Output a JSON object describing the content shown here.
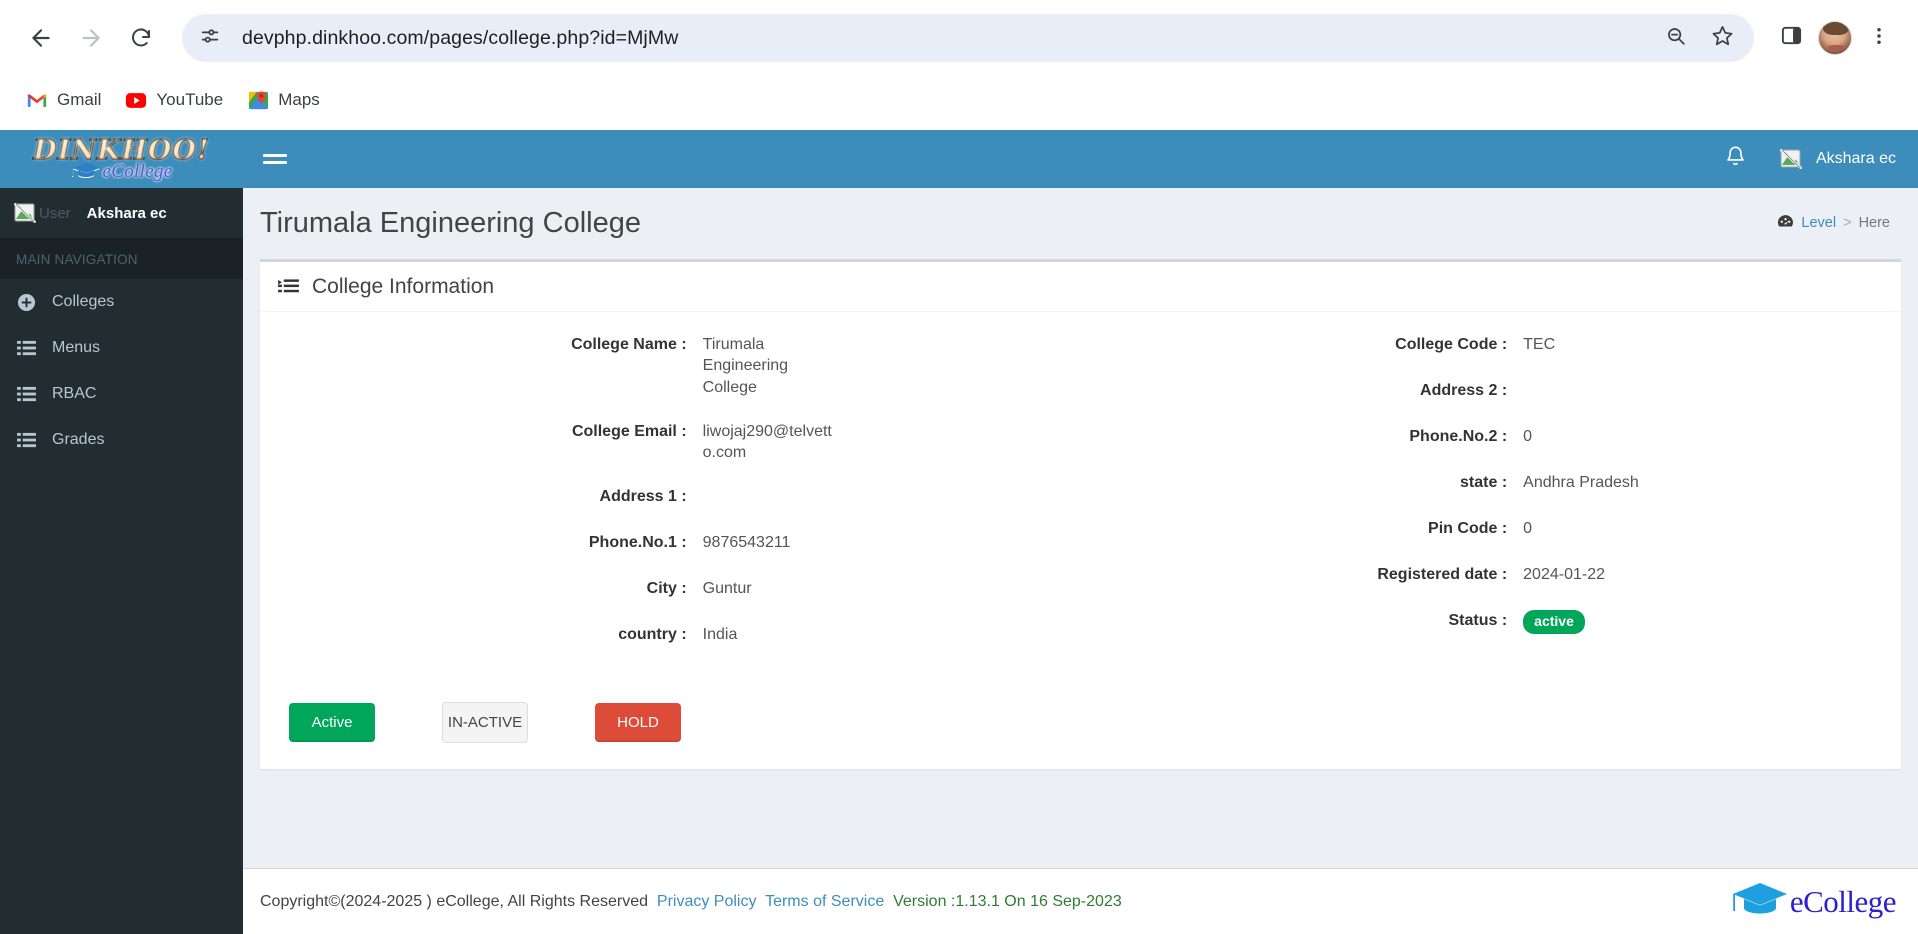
{
  "browser": {
    "url": "devphp.dinkhoo.com/pages/college.php?id=MjMw",
    "back_label": "Back",
    "forward_label": "Forward",
    "reload_label": "Reload",
    "site_info_label": "View site information",
    "zoom_label": "Zoom",
    "bookmark_label": "Bookmark this tab",
    "side_panel_label": "Side panel",
    "profile_label": "Profile",
    "menu_label": "Customize and control Google Chrome",
    "bookmarks": [
      {
        "label": "Gmail",
        "icon": "gmail-icon"
      },
      {
        "label": "YouTube",
        "icon": "youtube-icon"
      },
      {
        "label": "Maps",
        "icon": "maps-icon"
      }
    ]
  },
  "sidebar": {
    "logo_primary": "DINKHOO!",
    "logo_secondary": "eCollege",
    "user_alt_text": "User",
    "user_name": "Akshara ec",
    "nav_heading": "MAIN NAVIGATION",
    "items": [
      {
        "label": "Colleges",
        "icon": "plus-circle-icon"
      },
      {
        "label": "Menus",
        "icon": "list-icon"
      },
      {
        "label": "RBAC",
        "icon": "list-icon"
      },
      {
        "label": "Grades",
        "icon": "list-icon"
      }
    ]
  },
  "topbar": {
    "toggle_label": "Toggle navigation",
    "notifications_label": "Notifications",
    "user_name": "Akshara ec"
  },
  "page": {
    "title": "Tirumala Engineering College",
    "breadcrumb": {
      "icon": "dashboard-icon",
      "level": "Level",
      "separator": ">",
      "current": "Here"
    }
  },
  "card": {
    "title": "College Information",
    "icon": "list-alt-icon",
    "left_fields": [
      {
        "label": "College Name :",
        "value": "Tirumala Engineering College"
      },
      {
        "label": "College Email :",
        "value": "liwojaj290@telvetto.com"
      },
      {
        "label": "Address 1 :",
        "value": ""
      },
      {
        "label": "Phone.No.1 :",
        "value": "9876543211"
      },
      {
        "label": "City :",
        "value": "Guntur"
      },
      {
        "label": "country :",
        "value": "India"
      }
    ],
    "right_fields": [
      {
        "label": "College Code :",
        "value": "TEC"
      },
      {
        "label": "Address 2 :",
        "value": ""
      },
      {
        "label": "Phone.No.2 :",
        "value": "0"
      },
      {
        "label": "state :",
        "value": "Andhra Pradesh"
      },
      {
        "label": "Pin Code :",
        "value": "0"
      },
      {
        "label": "Registered date :",
        "value": "2024-01-22"
      },
      {
        "label": "Status :",
        "value": "active"
      }
    ],
    "status_label": "Status :",
    "status_value": "active",
    "buttons": {
      "active": "Active",
      "inactive": "IN-ACTIVE",
      "hold": "HOLD"
    }
  },
  "footer": {
    "copyright": "Copyright©(2024-2025 ) eCollege, All Rights Reserved",
    "privacy_policy": "Privacy Policy",
    "terms_of_service": "Terms of Service",
    "version": "Version :1.13.1 On 16 Sep-2023",
    "logo_text": "eCollege"
  },
  "colors": {
    "brand_blue": "#3c8dbc",
    "sidebar_dark": "#222d32",
    "success_green": "#00a65a",
    "danger_red": "#dd4b39",
    "body_bg": "#ecf0f5",
    "version_green": "#2e7d32"
  }
}
